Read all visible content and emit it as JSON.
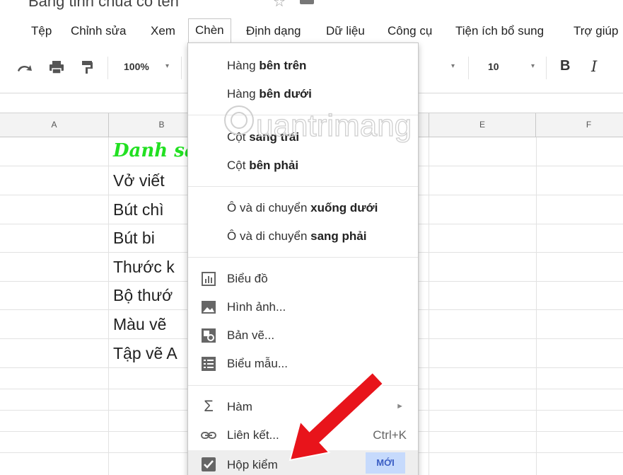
{
  "menubar": {
    "items": [
      {
        "label": "Tệp"
      },
      {
        "label": "Chỉnh sửa"
      },
      {
        "label": "Xem"
      },
      {
        "label": "Chèn"
      },
      {
        "label": "Định dạng"
      },
      {
        "label": "Dữ liệu"
      },
      {
        "label": "Công cụ"
      },
      {
        "label": "Tiện ích bổ sung"
      },
      {
        "label": "Trợ giúp"
      }
    ]
  },
  "toolbar": {
    "zoom": "100%",
    "font_size": "10",
    "bold_label": "B",
    "italic_label": "I"
  },
  "columns": [
    "A",
    "B",
    "E",
    "F"
  ],
  "cells": {
    "title": "Danh sác",
    "rows": [
      "Vở viết",
      "Bút chì",
      "Bút bi",
      "Thước k",
      "Bộ thướ",
      "Màu vẽ",
      "Tập vẽ A"
    ]
  },
  "insert_menu": {
    "groups": [
      [
        {
          "pre": "Hàng ",
          "bold": "bên trên"
        },
        {
          "pre": "Hàng ",
          "bold": "bên dưới"
        }
      ],
      [
        {
          "pre": "Cột ",
          "bold": "sang trái"
        },
        {
          "pre": "Cột ",
          "bold": "bên phải"
        }
      ],
      [
        {
          "pre": "Ô và di chuyển ",
          "bold": "xuống dưới"
        },
        {
          "pre": "Ô và di chuyển ",
          "bold": "sang phải"
        }
      ]
    ],
    "chart": "Biểu đồ",
    "image": "Hình ảnh...",
    "drawing": "Bản vẽ...",
    "form": "Biểu mẫu...",
    "function": "Hàm",
    "link": "Liên kết...",
    "link_shortcut": "Ctrl+K",
    "checkbox": "Hộp kiểm",
    "new_badge": "MỚI"
  },
  "colors": {
    "accent_green": "#22e022",
    "arrow_red": "#e8141b",
    "badge_bg": "#c6dafc"
  }
}
